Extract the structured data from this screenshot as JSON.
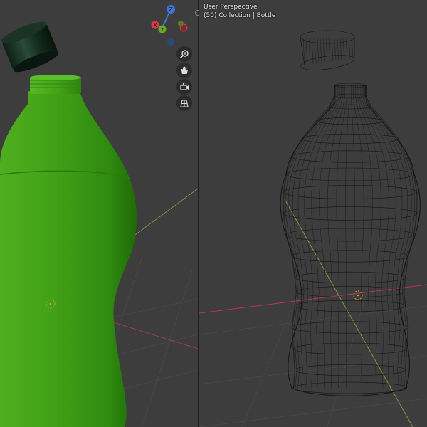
{
  "viewport_header": {
    "perspective_label": "User Perspective",
    "collection_label": "(50) Collection | Bottle"
  },
  "gizmo": {
    "z_label": "Z",
    "y_label": "Y",
    "x_label": "X",
    "x_color": "#d43a4a",
    "y_color": "#6ba82a",
    "z_color": "#3b78d8"
  },
  "colors": {
    "viewport_bg": "#3d3d3d",
    "bottle_green": "#3d9c15",
    "wire": "#141414",
    "x_axis_line": "#b43a4a",
    "y_axis_line": "#8aa040",
    "origin_marker": "#e8a020"
  },
  "nav_tools": [
    "zoom-icon",
    "hand-pan-icon",
    "camera-icon",
    "grid-view-icon"
  ]
}
